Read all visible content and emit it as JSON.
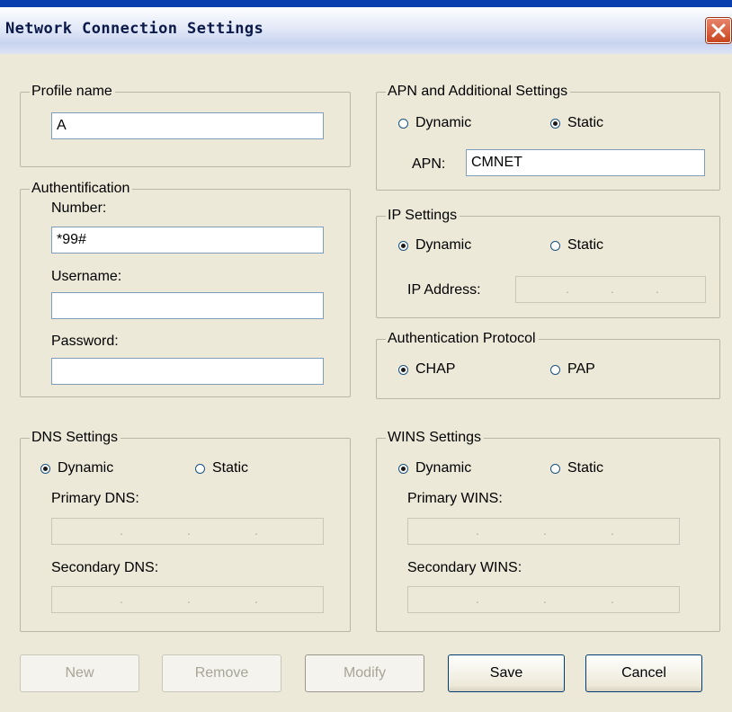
{
  "window": {
    "title": "Network Connection Settings"
  },
  "profile": {
    "legend": "Profile name",
    "value": "A"
  },
  "auth": {
    "legend": "Authentification",
    "number_label": "Number:",
    "number_value": "*99#",
    "username_label": "Username:",
    "username_value": "",
    "password_label": "Password:",
    "password_value": ""
  },
  "apn": {
    "legend": "APN and Additional Settings",
    "dynamic": "Dynamic",
    "static": "Static",
    "selected": "static",
    "apn_label": "APN:",
    "apn_value": "CMNET"
  },
  "ip": {
    "legend": "IP Settings",
    "dynamic": "Dynamic",
    "static": "Static",
    "selected": "dynamic",
    "address_label": "IP Address:"
  },
  "authproto": {
    "legend": "Authentication Protocol",
    "chap": "CHAP",
    "pap": "PAP",
    "selected": "chap"
  },
  "dns": {
    "legend": "DNS Settings",
    "dynamic": "Dynamic",
    "static": "Static",
    "selected": "dynamic",
    "primary_label": "Primary DNS:",
    "secondary_label": "Secondary DNS:"
  },
  "wins": {
    "legend": "WINS Settings",
    "dynamic": "Dynamic",
    "static": "Static",
    "selected": "dynamic",
    "primary_label": "Primary WINS:",
    "secondary_label": "Secondary  WINS:"
  },
  "ip_separator": ".",
  "buttons": {
    "new": {
      "label": "New",
      "enabled": false
    },
    "remove": {
      "label": "Remove",
      "enabled": false
    },
    "modify": {
      "label": "Modify",
      "enabled": false
    },
    "save": {
      "label": "Save",
      "enabled": true
    },
    "cancel": {
      "label": "Cancel",
      "enabled": true
    }
  },
  "icons": {
    "close": "close-icon"
  },
  "colors": {
    "dialog_bg": "#ece9d8",
    "close_button": "#d9593a",
    "field_border": "#7f9db9"
  }
}
